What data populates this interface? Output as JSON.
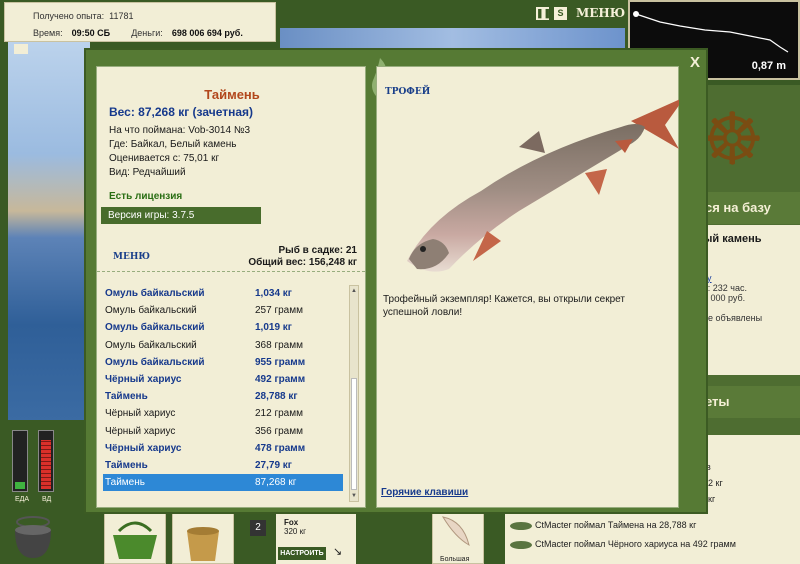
{
  "hud": {
    "exp_label": "Получено опыта:",
    "exp_value": "11781",
    "time_label": "Время:",
    "time_value": "09:50 СБ",
    "money_label": "Деньги:",
    "money_value": "698 006 694 руб.",
    "pause_icon": "pause-icon",
    "sound_icon": "sound-icon",
    "menu_label": "МЕНЮ",
    "depth_value": "0,87 m"
  },
  "background": {
    "base_button": "ся на базу",
    "location_title": "ый камень",
    "info_link": "ку",
    "info_lines": [
      "в: 232 час.",
      "5 000 руб.",
      "4",
      "не объявлены"
    ],
    "secrets_button": "еты",
    "chat": [
      "в",
      "2 кг",
      "кг",
      "CtMacter поймал Таймена на 28,788 кг",
      "CtMacter поймал Чёрного хариуса на 492 грамм"
    ],
    "gauges": [
      {
        "label": "ЕДА",
        "level": 0.12,
        "color": "#3fb33f"
      },
      {
        "label": "ВД",
        "level": 0.88,
        "color": "#d9302a"
      }
    ],
    "slot_number": "2",
    "lure_name": "Fox",
    "lure_weight": "320 кг",
    "setup_button": "НАСТРОИТЬ",
    "lure2_label": "Большая"
  },
  "modal": {
    "close_label": "X",
    "fish": {
      "title": "Таймень",
      "weight_line": "Вес: 87,268 кг (зачетная)",
      "bait": "На что поймана: Vob-3014 №3",
      "place": "Где: Байкал, Белый камень",
      "value": "Оценивается с: 75,01 кг",
      "kind": "Вид: Редчайший"
    },
    "license": "Есть лицензия",
    "version": "Версия игры: 3.7.5",
    "menu_label": "МЕНЮ",
    "net_count": "Рыб в садке: 21",
    "net_weight": "Общий вес: 156,248 кг",
    "catch": [
      {
        "name": "Омуль байкальский",
        "weight": "1,034 кг",
        "style": "hl"
      },
      {
        "name": "Омуль байкальский",
        "weight": "257 грамм",
        "style": "normal"
      },
      {
        "name": "Омуль байкальский",
        "weight": "1,019 кг",
        "style": "hl"
      },
      {
        "name": "Омуль байкальский",
        "weight": "368 грамм",
        "style": "normal"
      },
      {
        "name": "Омуль байкальский",
        "weight": "955 грамм",
        "style": "hl"
      },
      {
        "name": "Чёрный хариус",
        "weight": "492 грамм",
        "style": "hl"
      },
      {
        "name": "Таймень",
        "weight": "28,788 кг",
        "style": "hl"
      },
      {
        "name": "Чёрный хариус",
        "weight": "212 грамм",
        "style": "normal"
      },
      {
        "name": "Чёрный хариус",
        "weight": "356 грамм",
        "style": "normal"
      },
      {
        "name": "Чёрный хариус",
        "weight": "478 грамм",
        "style": "hl"
      },
      {
        "name": "Таймень",
        "weight": "27,79 кг",
        "style": "hl"
      },
      {
        "name": "Таймень",
        "weight": "87,268 кг",
        "style": "sel"
      }
    ],
    "trophy_label": "ТРОФЕЙ",
    "trophy_text": "Трофейный экземпляр! Кажется, вы открыли секрет успешной ловли!",
    "hotkeys": "Горячие клавиши"
  },
  "colors": {
    "panel_bg": "#f2eed6",
    "frame_green": "#567a34",
    "title_orange": "#b2471c",
    "link_blue": "#16398c",
    "selection_blue": "#2d88d6"
  }
}
